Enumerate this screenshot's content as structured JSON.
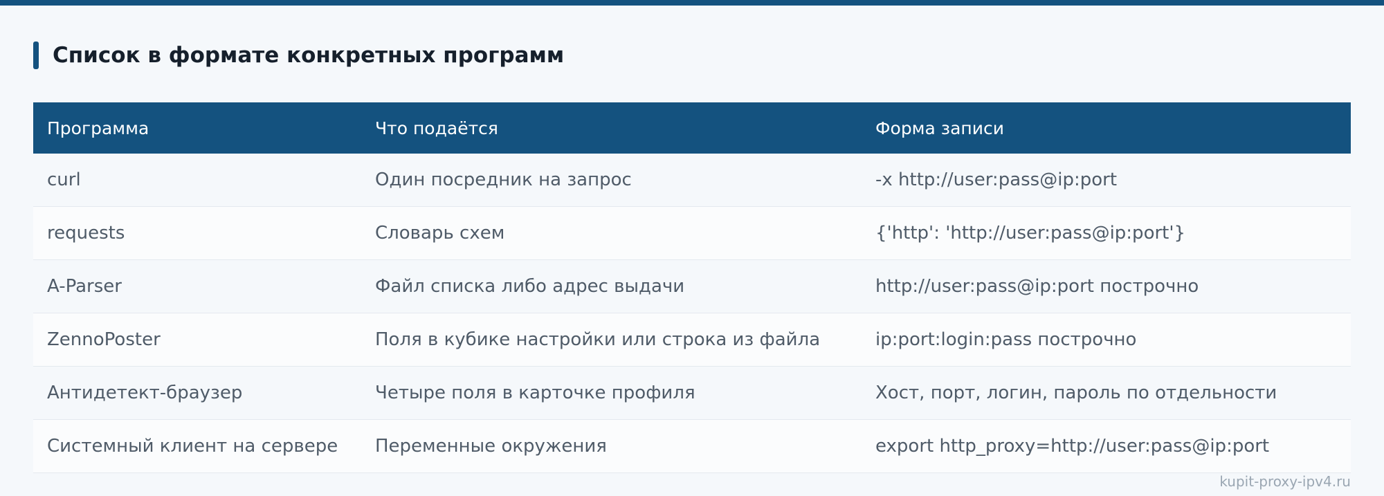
{
  "heading": "Список в формате конкретных программ",
  "table": {
    "headers": [
      "Программа",
      "Что подаётся",
      "Форма записи"
    ],
    "rows": [
      [
        "curl",
        "Один посредник на запрос",
        "-x http://user:pass@ip:port"
      ],
      [
        "requests",
        "Словарь схем",
        "{'http': 'http://user:pass@ip:port'}"
      ],
      [
        "A-Parser",
        "Файл списка либо адрес выдачи",
        "http://user:pass@ip:port построчно"
      ],
      [
        "ZennoPoster",
        "Поля в кубике настройки или строка из файла",
        "ip:port:login:pass построчно"
      ],
      [
        "Антидетект-браузер",
        "Четыре поля в карточке профиля",
        "Хост, порт, логин, пароль по отдельности"
      ],
      [
        "Системный клиент на сервере",
        "Переменные окружения",
        "export http_proxy=http://user:pass@ip:port"
      ]
    ]
  },
  "watermark": "kupit-proxy-ipv4.ru",
  "colors": {
    "accent": "#14527f",
    "background": "#f5f8fb",
    "text": "#4f5b68",
    "heading": "#16202c"
  }
}
